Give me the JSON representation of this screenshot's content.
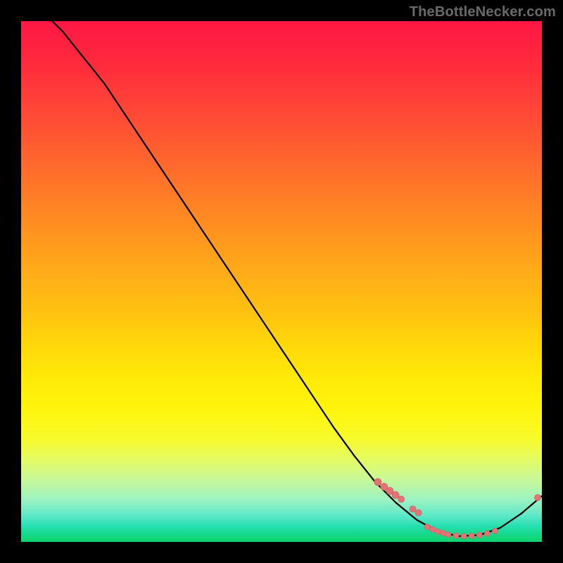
{
  "watermark": "TheBottleNecker.com",
  "colors": {
    "curve": "#000000",
    "dot_fill": "#e57373",
    "dot_stroke": "#d06464"
  },
  "chart_data": {
    "type": "line",
    "title": "",
    "xlabel": "",
    "ylabel": "",
    "xlim": [
      0,
      100
    ],
    "ylim": [
      0,
      100
    ],
    "grid": false,
    "legend": false,
    "curve": [
      {
        "x": 0,
        "y": 105
      },
      {
        "x": 4,
        "y": 102
      },
      {
        "x": 8,
        "y": 98
      },
      {
        "x": 12,
        "y": 93
      },
      {
        "x": 16,
        "y": 88
      },
      {
        "x": 20,
        "y": 82
      },
      {
        "x": 24,
        "y": 76
      },
      {
        "x": 28,
        "y": 70
      },
      {
        "x": 32,
        "y": 64
      },
      {
        "x": 36,
        "y": 58
      },
      {
        "x": 40,
        "y": 52
      },
      {
        "x": 44,
        "y": 46
      },
      {
        "x": 48,
        "y": 40
      },
      {
        "x": 52,
        "y": 34
      },
      {
        "x": 56,
        "y": 28
      },
      {
        "x": 60,
        "y": 22
      },
      {
        "x": 64,
        "y": 16.5
      },
      {
        "x": 68,
        "y": 11.5
      },
      {
        "x": 72,
        "y": 7.5
      },
      {
        "x": 76,
        "y": 4.2
      },
      {
        "x": 80,
        "y": 2.0
      },
      {
        "x": 84,
        "y": 1.1
      },
      {
        "x": 88,
        "y": 1.3
      },
      {
        "x": 92,
        "y": 2.7
      },
      {
        "x": 96,
        "y": 5.4
      },
      {
        "x": 100,
        "y": 8.8
      }
    ],
    "dot_clusters": [
      {
        "x": 68.5,
        "y": 11.5,
        "r": 5
      },
      {
        "x": 69.7,
        "y": 10.6,
        "r": 5
      },
      {
        "x": 70.8,
        "y": 9.8,
        "r": 5
      },
      {
        "x": 71.9,
        "y": 9.0,
        "r": 5
      },
      {
        "x": 73.0,
        "y": 8.2,
        "r": 4.5
      },
      {
        "x": 75.2,
        "y": 6.3,
        "r": 4.5
      },
      {
        "x": 76.3,
        "y": 5.6,
        "r": 4.5
      },
      {
        "x": 78.0,
        "y": 2.9,
        "r": 4
      },
      {
        "x": 79.0,
        "y": 2.4,
        "r": 4
      },
      {
        "x": 80.0,
        "y": 2.0,
        "r": 4
      },
      {
        "x": 81.0,
        "y": 1.7,
        "r": 4
      },
      {
        "x": 82.0,
        "y": 1.4,
        "r": 4
      },
      {
        "x": 83.5,
        "y": 1.2,
        "r": 4
      },
      {
        "x": 85.0,
        "y": 1.1,
        "r": 4
      },
      {
        "x": 86.5,
        "y": 1.15,
        "r": 4
      },
      {
        "x": 88.0,
        "y": 1.3,
        "r": 4
      },
      {
        "x": 89.5,
        "y": 1.6,
        "r": 4
      },
      {
        "x": 91.0,
        "y": 2.1,
        "r": 4
      },
      {
        "x": 99.2,
        "y": 8.5,
        "r": 4.5
      }
    ]
  }
}
